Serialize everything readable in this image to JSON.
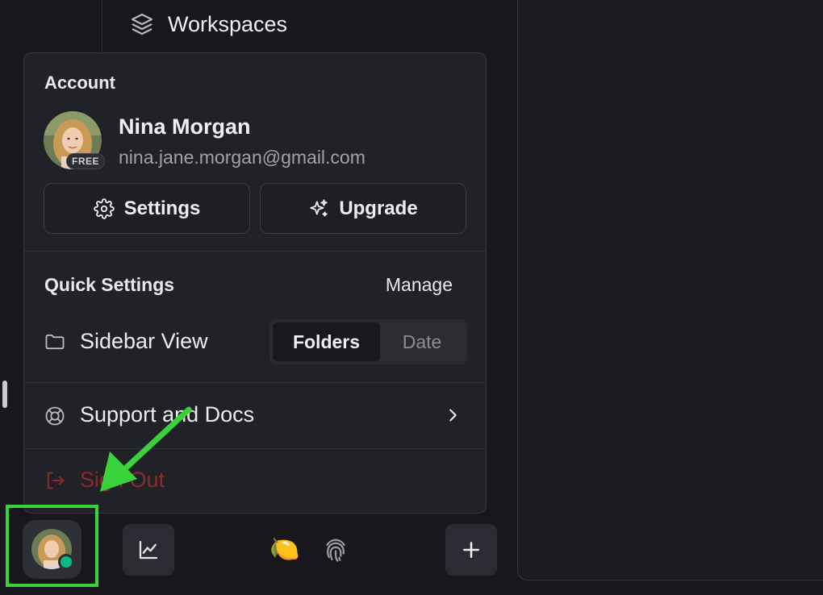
{
  "sidebar": {
    "workspaces_label": "Workspaces"
  },
  "account_menu": {
    "section_title": "Account",
    "user_name": "Nina Morgan",
    "user_email": "nina.jane.morgan@gmail.com",
    "plan_badge": "FREE",
    "settings_label": "Settings",
    "upgrade_label": "Upgrade",
    "quick_settings_title": "Quick Settings",
    "manage_label": "Manage",
    "sidebar_view_label": "Sidebar View",
    "sidebar_view_options": [
      "Folders",
      "Date"
    ],
    "sidebar_view_selected": "Folders",
    "support_label": "Support and Docs",
    "sign_out_label": "Sign Out"
  },
  "bottom_bar": {
    "lemon_emoji": "🍋",
    "status": "online"
  },
  "colors": {
    "accent_green": "#3ad23a",
    "status_online": "#10b981",
    "sign_out_red": "#8c2a2a"
  },
  "icons": {
    "workspaces": "layers-icon",
    "settings": "gear-icon",
    "upgrade": "sparkles-icon",
    "sidebar_view": "folder-icon",
    "support": "lifebuoy-icon",
    "sign_out": "sign-out-icon",
    "stats": "line-chart-icon",
    "fingerprint": "fingerprint-icon",
    "add": "plus-icon"
  }
}
